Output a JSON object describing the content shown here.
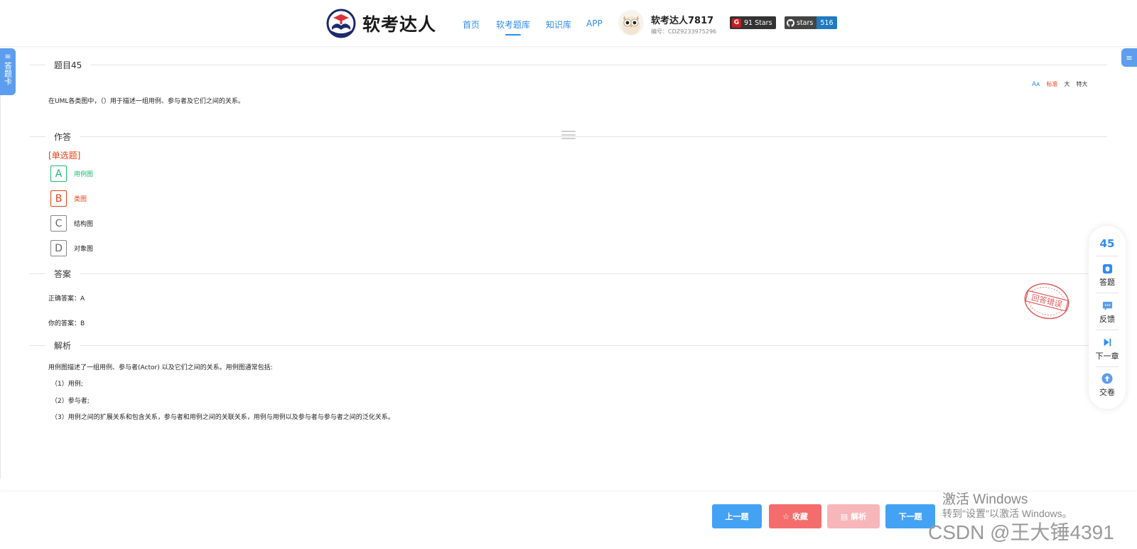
{
  "header": {
    "brand": "软考达人",
    "nav": [
      {
        "label": "首页",
        "active": false
      },
      {
        "label": "软考题库",
        "active": true
      },
      {
        "label": "知识库",
        "active": false
      },
      {
        "label": "APP",
        "active": false
      }
    ],
    "user": {
      "name": "软考达人7817",
      "id": "编号：CDZ9233975296"
    },
    "gitee_badge": {
      "label": "91 Stars",
      "color": "#c71d23"
    },
    "github_badge": {
      "left": "stars",
      "count": "516",
      "color": "#1f7bc1"
    }
  },
  "left_tab": {
    "label": "答题卡"
  },
  "question": {
    "section_title": "题目45",
    "text": "在UML各类图中，（）用于描述一组用例、参与者及它们之间的关系。",
    "font_options": {
      "standard": "标准",
      "large": "大",
      "xlarge": "特大"
    }
  },
  "answer_section": {
    "title": "作答",
    "type": "[单选题]",
    "options": [
      {
        "key": "A",
        "text": "用例图",
        "state": "correct"
      },
      {
        "key": "B",
        "text": "类图",
        "state": "wrong"
      },
      {
        "key": "C",
        "text": "结构图",
        "state": "normal"
      },
      {
        "key": "D",
        "text": "对象图",
        "state": "normal"
      }
    ]
  },
  "result": {
    "title": "答案",
    "correct_answer": "正确答案：A",
    "your_answer": "你的答案：B",
    "stamp": "回答错误"
  },
  "analysis": {
    "title": "解析",
    "lines": [
      "用例图描述了一组用例、参与者(Actor) 以及它们之间的关系。用例图通常包括:",
      "（1）用例;",
      "（2）参与者;",
      "（3）用例之间的扩展关系和包含关系，参与者和用例之间的关联关系，用例与用例以及参与者与参与者之间的泛化关系。"
    ]
  },
  "side_panel": {
    "number": "45",
    "items": [
      {
        "label": "答题",
        "icon": "answer-icon"
      },
      {
        "label": "反馈",
        "icon": "feedback-icon"
      },
      {
        "label": "下一章",
        "icon": "next-chapter-icon"
      },
      {
        "label": "交卷",
        "icon": "submit-icon"
      }
    ]
  },
  "bottom": {
    "prev": "上一题",
    "favorite": "收藏",
    "analysis": "解析",
    "next": "下一题"
  },
  "watermarks": {
    "activate_title": "激活 Windows",
    "activate_sub": "转到\"设置\"以激活 Windows。",
    "csdn": "CSDN @王大锤4391"
  },
  "colors": {
    "accent": "#2d8cf0",
    "correct": "#19be6b",
    "wrong": "#ed4014",
    "btn_blue": "#44a2f5",
    "btn_red": "#f56c6c",
    "btn_pink": "#f7b6ba"
  }
}
